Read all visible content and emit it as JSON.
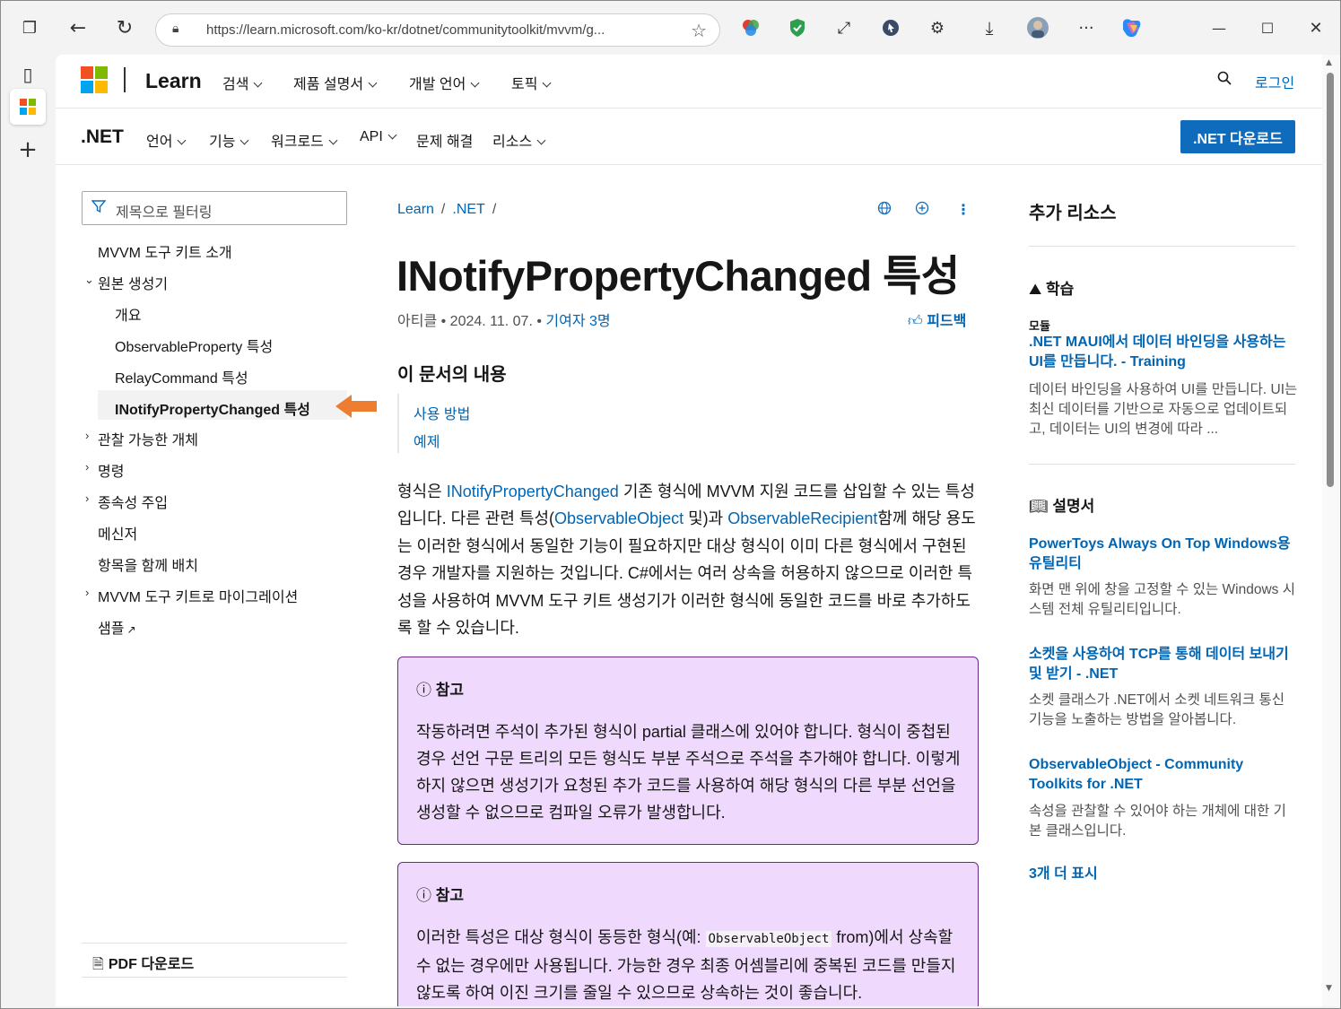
{
  "browser": {
    "url": "https://learn.microsoft.com/ko-kr/dotnet/communitytoolkit/mvvm/g...",
    "window_controls": [
      "minimize",
      "maximize",
      "close"
    ]
  },
  "header": {
    "brand": "Learn",
    "nav": [
      "검색",
      "제품 설명서",
      "개발 언어",
      "토픽"
    ],
    "login": "로그인"
  },
  "subheader": {
    "title": ".NET",
    "nav": [
      "언어",
      "기능",
      "워크로드",
      "API",
      "문제 해결",
      "리소스"
    ],
    "download_button": ".NET 다운로드"
  },
  "toc": {
    "filter_placeholder": "제목으로 필터링",
    "items": [
      "MVVM 도구 키트 소개",
      "원본 생성기",
      "개요",
      "ObservableProperty 특성",
      "RelayCommand 특성",
      "INotifyPropertyChanged 특성",
      "관찰 가능한 개체",
      "명령",
      "종속성 주입",
      "메신저",
      "항목을 함께 배치",
      "MVVM 도구 키트로 마이그레이션",
      "샘플"
    ],
    "pdf": "PDF 다운로드"
  },
  "article": {
    "breadcrumb": [
      "Learn",
      ".NET"
    ],
    "title": "INotifyPropertyChanged 특성",
    "meta_type": "아티클",
    "meta_date": "2024. 11. 07.",
    "meta_contributors": "기여자 3명",
    "feedback": "피드백",
    "in_this_article": "이 문서의 내용",
    "in_this_links": [
      "사용 방법",
      "예제"
    ],
    "para_1": "형식은",
    "para_link_1": "INotifyPropertyChanged",
    "para_2": " 기존 형식에 MVVM 지원 코드를 삽입할 수 있는 특성입니다. 다른 관련 특성(",
    "para_link_2": "ObservableObject",
    "para_3": " 및)과 ",
    "para_link_3": "ObservableRecipient",
    "para_4": "함께 해당 용도는 이러한 형식에서 동일한 기능이 필요하지만 대상 형식이 이미 다른 형식에서 구현된 경우 개발자를 지원하는 것입니다. C#에서는 여러 상속을 허용하지 않으므로 이러한 특성을 사용하여 MVVM 도구 키트 생성기가 이러한 형식에 동일한 코드를 바로 추가하도록 할 수 있습니다.",
    "note1_title": "참고",
    "note1_body": "작동하려면 주석이 추가된 형식이 partial 클래스에 있어야 합니다. 형식이 중첩된 경우 선언 구문 트리의 모든 형식도 부분 주석으로 주석을 추가해야 합니다. 이렇게 하지 않으면 생성기가 요청된 추가 코드를 사용하여 해당 형식의 다른 부분 선언을 생성할 수 없으므로 컴파일 오류가 발생합니다.",
    "note2_title": "참고",
    "note2_body_1": "이러한 특성은 대상 형식이 동등한 형식(예: ",
    "note2_code": "ObservableObject",
    "note2_body_2": " from)에서 상속할 수 없는 경우에만 사용됩니다. 가능한 경우 최종 어셈블리에 중복된 코드를 만들지 않도록 하여 이진 크기를 줄일 수 있으므로 상속하는 것이 좋습니다."
  },
  "resources": {
    "heading": "추가 리소스",
    "learn_heading": "학습",
    "module_label": "모듈",
    "module_link": ".NET MAUI에서 데이터 바인딩을 사용하는 UI를 만듭니다. - Training",
    "module_desc": "데이터 바인딩을 사용하여 UI를 만듭니다. UI는 최신 데이터를 기반으로 자동으로 업데이트되고, 데이터는 UI의 변경에 따라 ...",
    "docs_heading": "설명서",
    "docs": [
      {
        "title": "PowerToys Always On Top Windows용 유틸리티",
        "desc": "화면 맨 위에 창을 고정할 수 있는 Windows 시스템 전체 유틸리티입니다."
      },
      {
        "title": "소켓을 사용하여 TCP를 통해 데이터 보내기 및 받기 - .NET",
        "desc": "소켓 클래스가 .NET에서 소켓 네트워크 통신 기능을 노출하는 방법을 알아봅니다."
      },
      {
        "title": "ObservableObject - Community Toolkits for .NET",
        "desc": "속성을 관찰할 수 있어야 하는 개체에 대한 기본 클래스입니다."
      }
    ],
    "show_more": "3개 더 표시"
  },
  "colors": {
    "link": "#0065b3",
    "accent": "#0f6cbd",
    "note_bg": "#efd9fd",
    "arrow": "#ed7d31"
  }
}
